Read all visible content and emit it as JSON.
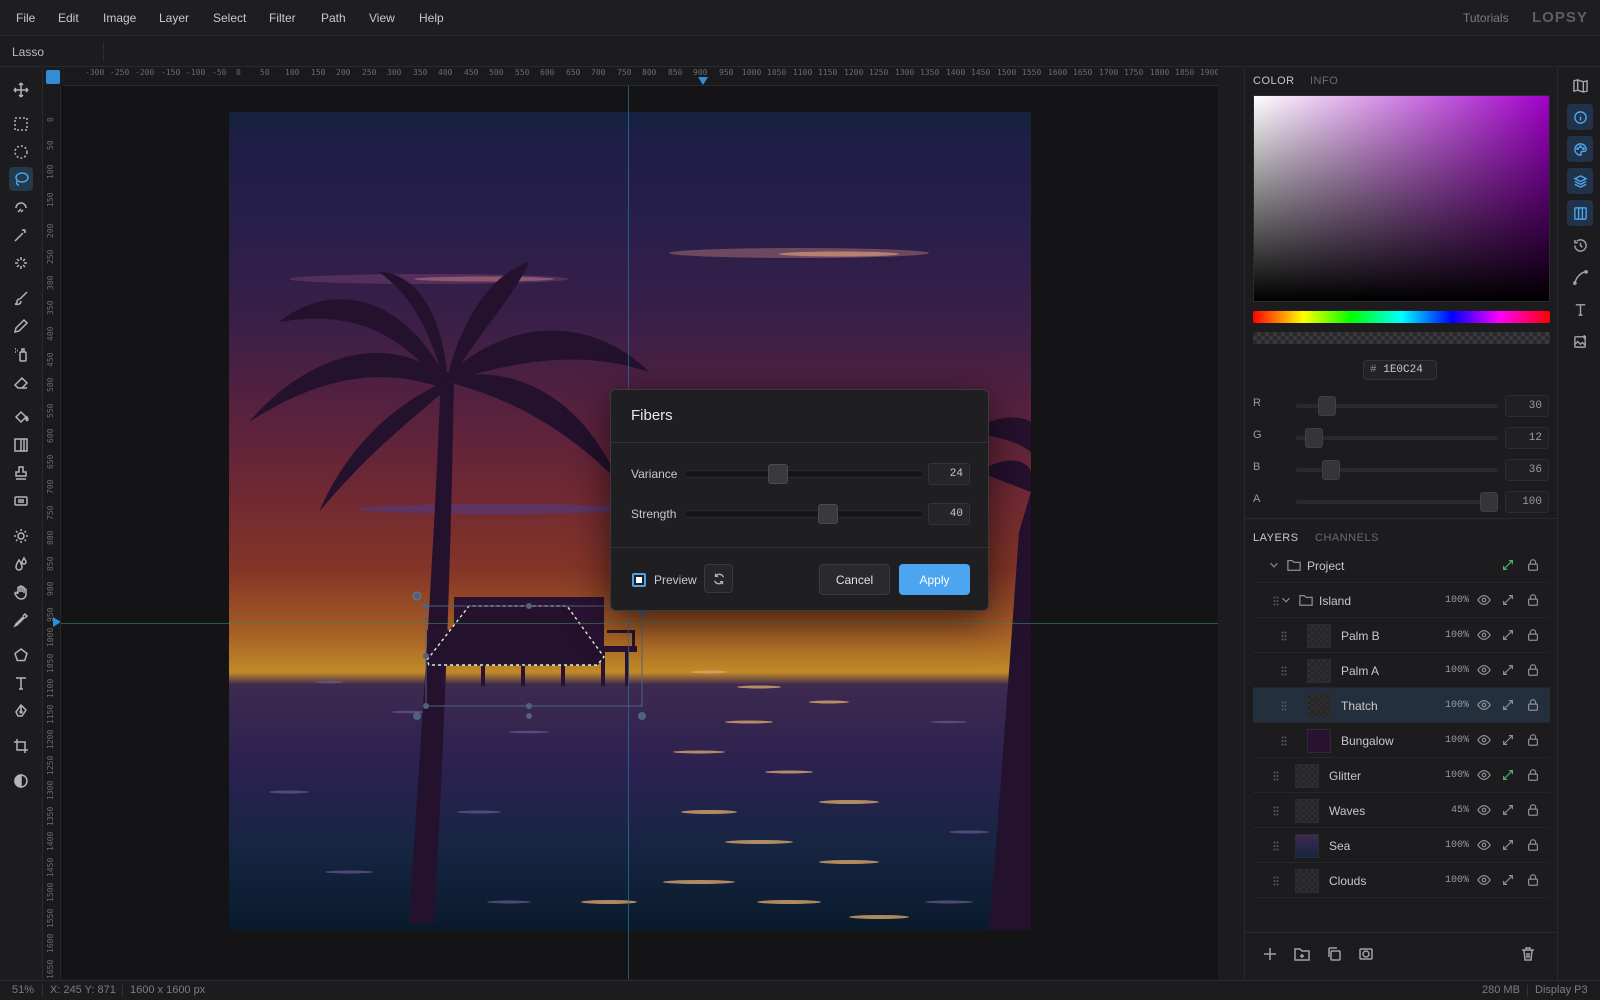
{
  "menu": [
    "File",
    "Edit",
    "Image",
    "Layer",
    "Select",
    "Filter",
    "Path",
    "View",
    "Help"
  ],
  "header": {
    "tutorials": "Tutorials",
    "logo": "LOPSY"
  },
  "options": {
    "tool_name": "Lasso"
  },
  "rulers": {
    "horizontal": [
      "-300",
      "-250",
      "-200",
      "-150",
      "-100",
      "-50",
      "0",
      "50",
      "100",
      "150",
      "200",
      "250",
      "300",
      "350",
      "400",
      "450",
      "500",
      "550",
      "600",
      "650",
      "700",
      "750",
      "800",
      "850",
      "900",
      "950",
      "1000",
      "1050",
      "1100",
      "1150",
      "1200",
      "1250",
      "1300",
      "1350",
      "1400",
      "1450",
      "1500",
      "1550",
      "1600",
      "1650",
      "1700",
      "1750",
      "1800",
      "1850",
      "1900"
    ],
    "vertical": [
      "0",
      "50",
      "100",
      "150",
      "200",
      "250",
      "300",
      "350",
      "400",
      "450",
      "500",
      "550",
      "600",
      "650",
      "700",
      "750",
      "800",
      "850",
      "900",
      "950",
      "1000",
      "1050",
      "1100",
      "1150",
      "1200",
      "1250",
      "1300",
      "1350",
      "1400",
      "1450",
      "1500",
      "1550",
      "1600",
      "1650"
    ]
  },
  "dialog": {
    "title": "Fibers",
    "variance_label": "Variance",
    "variance_value": "24",
    "variance_fraction": 0.38,
    "strength_label": "Strength",
    "strength_value": "40",
    "strength_fraction": 0.61,
    "preview_label": "Preview",
    "preview_checked": true,
    "cancel_label": "Cancel",
    "apply_label": "Apply"
  },
  "color_panel": {
    "tabs": [
      "COLOR",
      "INFO"
    ],
    "hex_prefix": "#",
    "hex": "1E0C24",
    "channels": [
      {
        "label": "R",
        "value": "30",
        "fraction": 0.12
      },
      {
        "label": "G",
        "value": "12",
        "fraction": 0.05
      },
      {
        "label": "B",
        "value": "36",
        "fraction": 0.14
      },
      {
        "label": "A",
        "value": "100",
        "fraction": 1.0
      }
    ],
    "accent": "#4BA5F0"
  },
  "layers_panel": {
    "tabs": [
      "LAYERS",
      "CHANNELS"
    ],
    "layers": [
      {
        "name": "Project",
        "opacity": "",
        "type": "folder",
        "depth": 0
      },
      {
        "name": "Island",
        "opacity": "100%",
        "type": "folder",
        "depth": 1
      },
      {
        "name": "Palm B",
        "opacity": "100%",
        "type": "layer",
        "depth": 2
      },
      {
        "name": "Palm A",
        "opacity": "100%",
        "type": "layer",
        "depth": 2
      },
      {
        "name": "Thatch",
        "opacity": "100%",
        "type": "layer",
        "depth": 2,
        "selected": true
      },
      {
        "name": "Bungalow",
        "opacity": "100%",
        "type": "layer",
        "depth": 2
      },
      {
        "name": "Glitter",
        "opacity": "100%",
        "type": "layer",
        "depth": 1
      },
      {
        "name": "Waves",
        "opacity": "45%",
        "type": "layer",
        "depth": 1
      },
      {
        "name": "Sea",
        "opacity": "100%",
        "type": "layer",
        "depth": 1
      },
      {
        "name": "Clouds",
        "opacity": "100%",
        "type": "layer",
        "depth": 1
      }
    ]
  },
  "status": {
    "zoom": "51%",
    "coords": "X: 245 Y: 871",
    "doc_size": "1600 x 1600 px",
    "memory": "280 MB",
    "profile": "Display P3"
  }
}
